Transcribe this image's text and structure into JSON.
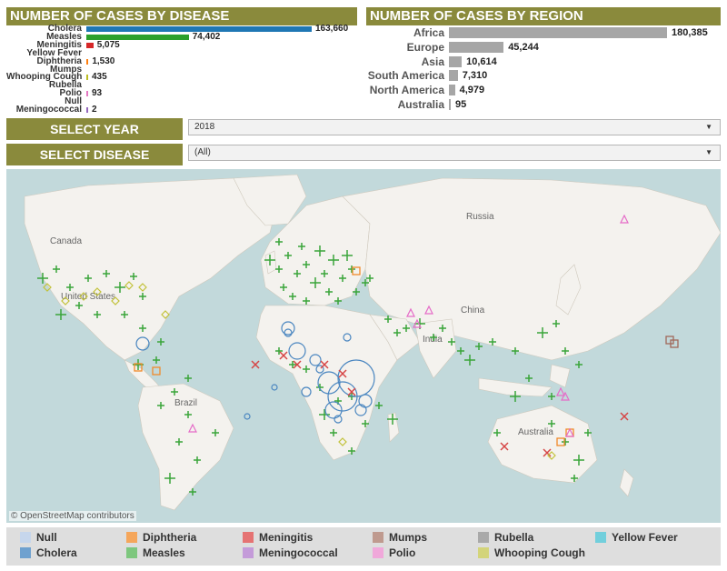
{
  "disease_panel": {
    "title": "NUMBER OF CASES BY DISEASE",
    "bars": [
      {
        "label": "Cholera",
        "value": 163660,
        "value_label": "163,660",
        "color": "#1f77b4"
      },
      {
        "label": "Measles",
        "value": 74402,
        "value_label": "74,402",
        "color": "#2ca02c"
      },
      {
        "label": "Meningitis",
        "value": 5075,
        "value_label": "5,075",
        "color": "#d62728"
      },
      {
        "label": "Yellow Fever",
        "value": 0,
        "value_label": "",
        "color": "#17becf"
      },
      {
        "label": "Diphtheria",
        "value": 1530,
        "value_label": "1,530",
        "color": "#ff7f0e"
      },
      {
        "label": "Mumps",
        "value": 0,
        "value_label": "",
        "color": "#8c564b"
      },
      {
        "label": "Whooping Cough",
        "value": 435,
        "value_label": "435",
        "color": "#bcbd22"
      },
      {
        "label": "Rubella",
        "value": 0,
        "value_label": "",
        "color": "#999999"
      },
      {
        "label": "Polio",
        "value": 93,
        "value_label": "93",
        "color": "#e377c2"
      },
      {
        "label": "Null",
        "value": 0,
        "value_label": "",
        "color": "#aec7e8"
      },
      {
        "label": "Meningococcal",
        "value": 2,
        "value_label": "2",
        "color": "#9467bd"
      }
    ]
  },
  "region_panel": {
    "title": "NUMBER OF CASES BY REGION",
    "bars": [
      {
        "label": "Africa",
        "value": 180385,
        "value_label": "180,385"
      },
      {
        "label": "Europe",
        "value": 45244,
        "value_label": "45,244"
      },
      {
        "label": "Asia",
        "value": 10614,
        "value_label": "10,614"
      },
      {
        "label": "South America",
        "value": 7310,
        "value_label": "7,310"
      },
      {
        "label": "North America",
        "value": 4979,
        "value_label": "4,979"
      },
      {
        "label": "Australia",
        "value": 95,
        "value_label": "95"
      }
    ]
  },
  "filters": {
    "year": {
      "label": "SELECT YEAR",
      "value": "2018"
    },
    "disease": {
      "label": "SELECT DISEASE",
      "value": "(All)"
    }
  },
  "map": {
    "attribution": "© OpenStreetMap contributors",
    "labels": {
      "canada": "Canada",
      "russia": "Russia",
      "us": "United States",
      "china": "China",
      "india": "India",
      "brazil": "Brazil",
      "australia": "Australia"
    }
  },
  "legend": {
    "items": [
      {
        "label": "Null",
        "color": "#c6d6ec"
      },
      {
        "label": "Diphtheria",
        "color": "#f5a65b"
      },
      {
        "label": "Meningitis",
        "color": "#e57373"
      },
      {
        "label": "Mumps",
        "color": "#bf9a8f"
      },
      {
        "label": "Rubella",
        "color": "#a9a9a9"
      },
      {
        "label": "Yellow Fever",
        "color": "#72cfdc"
      },
      {
        "label": "Cholera",
        "color": "#6fa1cf"
      },
      {
        "label": "Measles",
        "color": "#7ec77e"
      },
      {
        "label": "Meningococcal",
        "color": "#c49bd9"
      },
      {
        "label": "Polio",
        "color": "#f0a8da"
      },
      {
        "label": "Whooping Cough",
        "color": "#d3d47a"
      }
    ]
  }
}
